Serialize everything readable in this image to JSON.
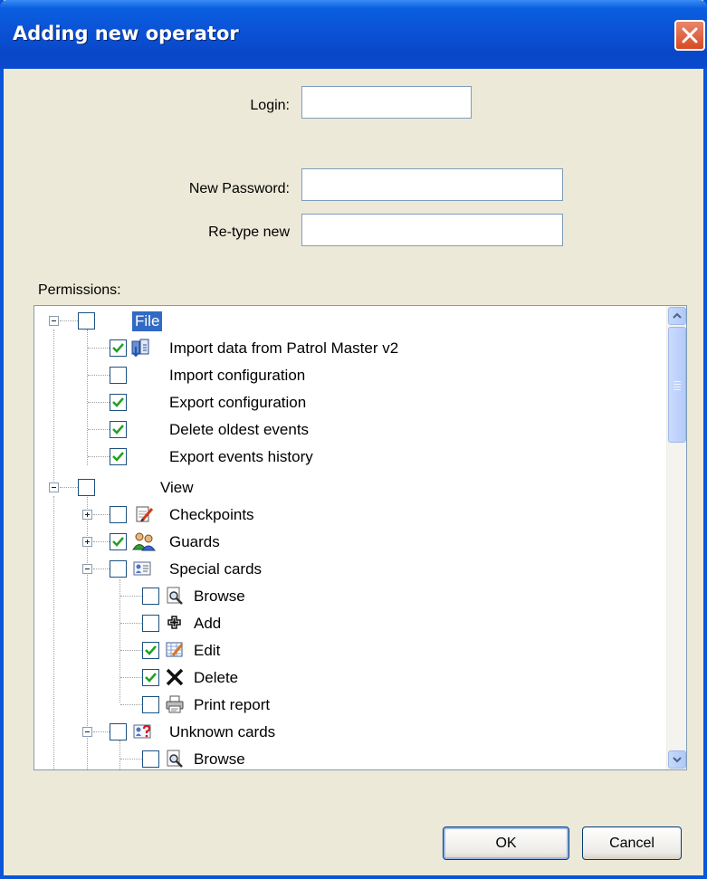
{
  "window": {
    "title": "Adding new operator"
  },
  "form": {
    "login_label": "Login:",
    "login_value": "",
    "new_password_label": "New Password:",
    "new_password_value": "",
    "retype_label": "Re-type new",
    "retype_value": ""
  },
  "permissions": {
    "label": "Permissions:",
    "tree": [
      {
        "label": "File",
        "checked": false,
        "expanded": true,
        "selected": true
      },
      {
        "label": "Import data from Patrol Master v2",
        "checked": true,
        "icon": "import-db-icon"
      },
      {
        "label": "Import configuration",
        "checked": false
      },
      {
        "label": "Export configuration",
        "checked": true
      },
      {
        "label": "Delete oldest events",
        "checked": true
      },
      {
        "label": "Export events history",
        "checked": true
      },
      {
        "label": "View",
        "checked": false,
        "expanded": true
      },
      {
        "label": "Checkpoints",
        "checked": false,
        "expanded": false,
        "icon": "checkpoints-icon"
      },
      {
        "label": "Guards",
        "checked": true,
        "expanded": false,
        "icon": "guards-icon"
      },
      {
        "label": "Special cards",
        "checked": false,
        "expanded": true,
        "icon": "special-cards-icon"
      },
      {
        "label": "Browse",
        "checked": false,
        "icon": "browse-icon"
      },
      {
        "label": "Add",
        "checked": false,
        "icon": "add-icon"
      },
      {
        "label": "Edit",
        "checked": true,
        "icon": "edit-icon"
      },
      {
        "label": "Delete",
        "checked": true,
        "icon": "delete-icon"
      },
      {
        "label": "Print report",
        "checked": false,
        "icon": "print-icon"
      },
      {
        "label": "Unknown cards",
        "checked": false,
        "expanded": true,
        "icon": "unknown-cards-icon"
      },
      {
        "label": "Browse",
        "checked": false,
        "icon": "browse-icon"
      }
    ]
  },
  "buttons": {
    "ok": "OK",
    "cancel": "Cancel"
  },
  "colors": {
    "titlebar": "#0b52d6",
    "dialog_bg": "#ece9d8",
    "selection": "#316ac5",
    "check": "#21a121"
  }
}
